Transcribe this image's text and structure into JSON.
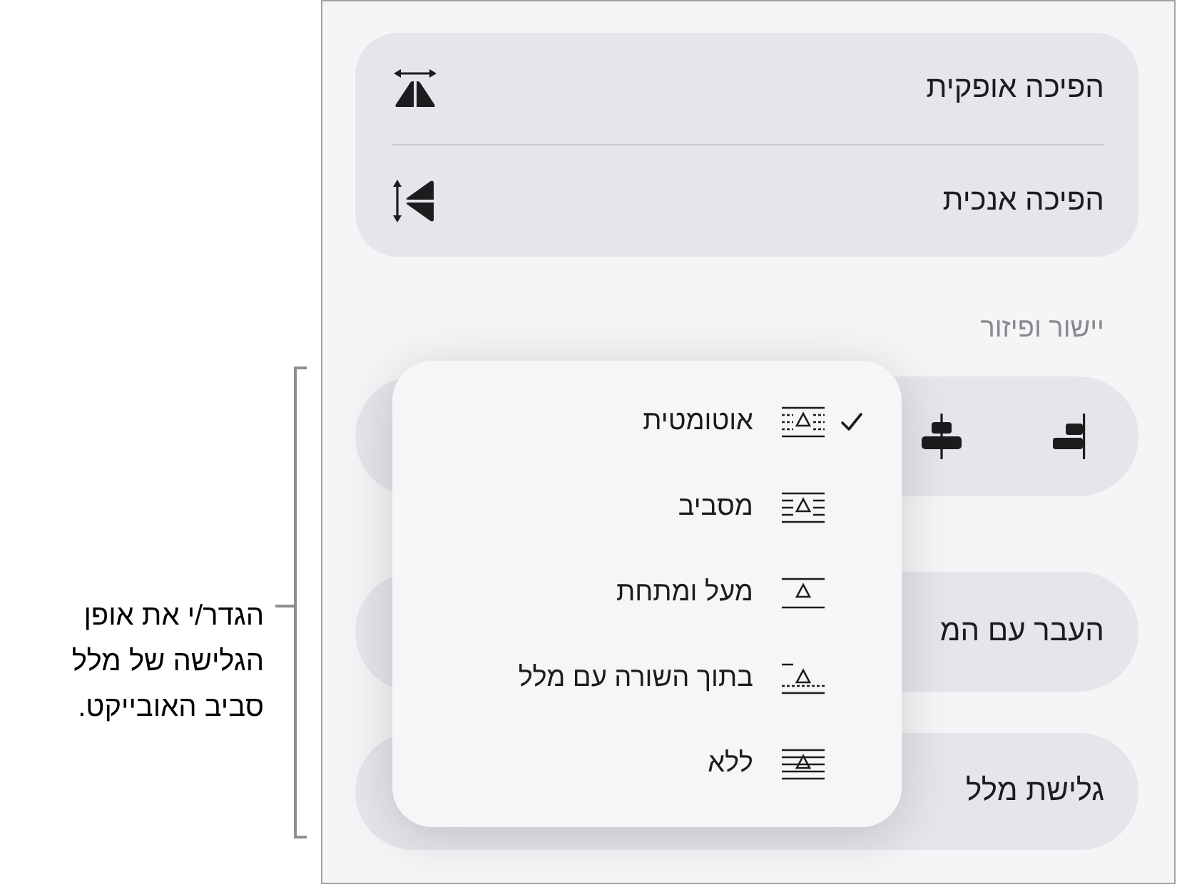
{
  "callout": {
    "text": "הגדר/י את אופן הגלישה של מלל סביב האובייקט."
  },
  "flip_options": [
    {
      "label": "הפיכה אופקית"
    },
    {
      "label": "הפיכה אנכית"
    }
  ],
  "section_header": "יישור ופיזור",
  "rows": [
    {
      "label": "העבר עם המ"
    },
    {
      "label": "גלישת מלל"
    }
  ],
  "wrap_menu": {
    "items": [
      {
        "label": "אוטומטית",
        "selected": true
      },
      {
        "label": "מסביב",
        "selected": false
      },
      {
        "label": "מעל ומתחת",
        "selected": false
      },
      {
        "label": "בתוך השורה עם מלל",
        "selected": false
      },
      {
        "label": "ללא",
        "selected": false
      }
    ]
  }
}
